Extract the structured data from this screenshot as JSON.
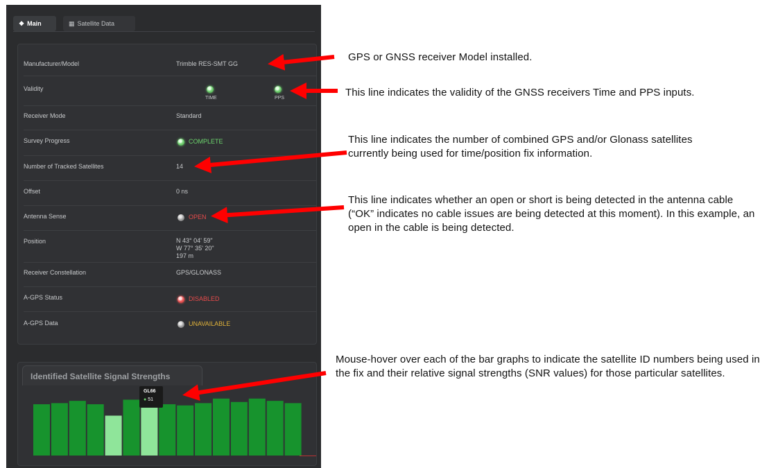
{
  "tabs": [
    {
      "icon": "info-icon",
      "label": "Main"
    },
    {
      "icon": "table-icon",
      "label": "Satellite Data"
    }
  ],
  "rows": {
    "manufacturer": {
      "label": "Manufacturer/Model",
      "value": "Trimble RES-SMT GG"
    },
    "validity": {
      "label": "Validity",
      "time_caption": "TIME",
      "pps_caption": "PPS"
    },
    "receiver_mode": {
      "label": "Receiver Mode",
      "value": "Standard"
    },
    "survey_progress": {
      "label": "Survey Progress",
      "status": "COMPLETE"
    },
    "tracked_satellites": {
      "label": "Number of Tracked Satellites",
      "value": "14"
    },
    "offset": {
      "label": "Offset",
      "value": "0 ns"
    },
    "antenna_sense": {
      "label": "Antenna Sense",
      "status": "OPEN"
    },
    "position": {
      "label": "Position",
      "lat": "N 43° 04' 59\"",
      "lon": "W 77° 35' 20\"",
      "alt": "197 m"
    },
    "constellation": {
      "label": "Receiver Constellation",
      "value": "GPS/GLONASS"
    },
    "agps_status": {
      "label": "A-GPS Status",
      "status": "DISABLED"
    },
    "agps_data": {
      "label": "A-GPS Data",
      "status": "UNAVAILABLE"
    }
  },
  "colors": {
    "ok": "#6dd66d",
    "error": "#e84b4b",
    "warn": "#e0b23a",
    "bar": "#17932d",
    "bar_highlight": "#8fe59a"
  },
  "chart": {
    "title": "Identified Satellite Signal Strengths",
    "tooltip_id": "GL66",
    "tooltip_value": "51"
  },
  "chart_data": {
    "type": "bar",
    "title": "Identified Satellite Signal Strengths",
    "values": [
      45,
      46,
      48,
      45,
      35,
      49,
      51,
      45,
      44,
      46,
      50,
      47,
      50,
      48,
      46
    ],
    "highlighted": [
      4,
      6
    ],
    "ylim": [
      0,
      70
    ]
  },
  "annotations": [
    "GPS or GNSS receiver Model installed.",
    "This line indicates the validity of the GNSS receivers Time and PPS inputs.",
    "This line indicates the number of combined GPS and/or Glonass satellites currently being used for time/position fix information.",
    "This line indicates whether an open or short is being detected in the antenna cable (“OK” indicates no cable issues are being detected at this moment).  In this example, an open in the cable is being detected.",
    "Mouse-hover over each of the bar graphs to indicate the satellite ID numbers being used in the fix and their relative signal strengths (SNR values) for those particular satellites."
  ]
}
